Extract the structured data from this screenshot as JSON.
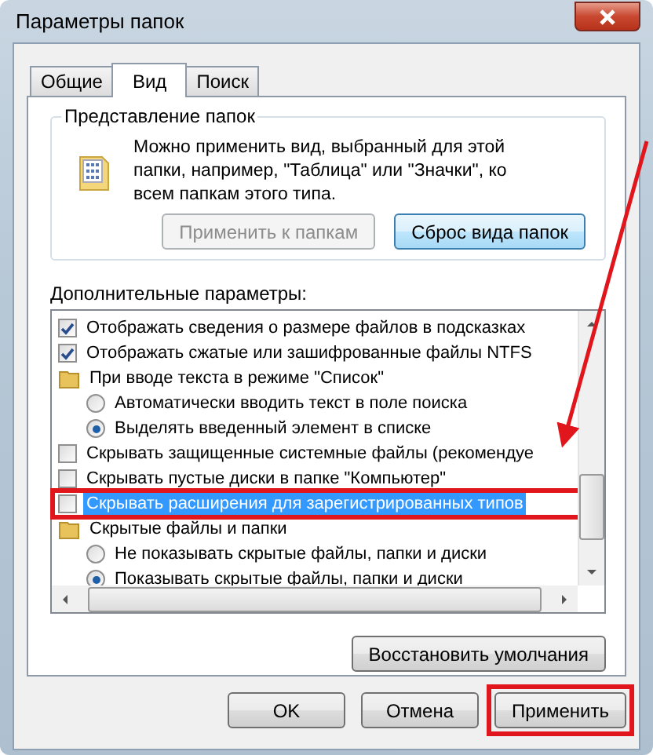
{
  "window": {
    "title": "Параметры папок"
  },
  "tabs": [
    {
      "label": "Общие",
      "selected": false
    },
    {
      "label": "Вид",
      "selected": true
    },
    {
      "label": "Поиск",
      "selected": false
    }
  ],
  "folder_views": {
    "title": "Представление папок",
    "description": "Можно применить вид, выбранный для этой папки, например, \"Таблица\" или \"Значки\", ко всем папкам этого типа.",
    "buttons": [
      {
        "label": "Применить к папкам",
        "disabled": true
      },
      {
        "label": "Сброс вида папок",
        "disabled": false
      }
    ]
  },
  "advanced": {
    "label": "Дополнительные параметры:",
    "items": [
      {
        "kind": "checkbox",
        "label": "Отображать сведения о размере файлов в подсказках",
        "checked": true,
        "selected": false
      },
      {
        "kind": "checkbox",
        "label": "Отображать сжатые или зашифрованные файлы NTFS",
        "checked": true,
        "selected": false
      },
      {
        "kind": "folder",
        "label": "При вводе текста в режиме \"Список\"",
        "children": [
          {
            "kind": "radio",
            "label": "Автоматически вводить текст в поле поиска",
            "checked": false,
            "selected": false
          },
          {
            "kind": "radio",
            "label": "Выделять введенный элемент в списке",
            "checked": true,
            "selected": false
          }
        ]
      },
      {
        "kind": "checkbox",
        "label": "Скрывать защищенные системные файлы (рекомендуе",
        "checked": false,
        "selected": false
      },
      {
        "kind": "checkbox",
        "label": "Скрывать пустые диски в папке \"Компьютер\"",
        "checked": false,
        "selected": false
      },
      {
        "kind": "checkbox",
        "label": "Скрывать расширения для зарегистрированных типов",
        "checked": false,
        "selected": true,
        "highlighted": true
      },
      {
        "kind": "folder",
        "label": "Скрытые файлы и папки",
        "children": [
          {
            "kind": "radio",
            "label": "Не показывать скрытые файлы, папки и диски",
            "checked": false,
            "selected": false
          },
          {
            "kind": "radio",
            "label": "Показывать скрытые файлы, папки и диски",
            "checked": true,
            "selected": false
          }
        ]
      }
    ],
    "restore_button": "Восстановить умолчания"
  },
  "pointer_arrow": true,
  "buttons": [
    {
      "label": "OK",
      "highlighted": false
    },
    {
      "label": "Отмена",
      "highlighted": false
    },
    {
      "label": "Применить",
      "highlighted": true
    }
  ]
}
